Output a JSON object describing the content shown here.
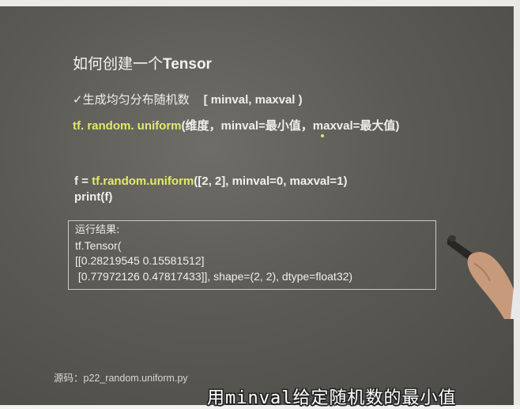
{
  "slide": {
    "title_cn": "如何创建一个",
    "title_en": "Tensor",
    "bullet": "✓生成均匀分布随机数",
    "bullet_range": "[ minval, maxval )",
    "api_prefix": "tf. random. uniform",
    "api_args": "(维度，minval=最小值，maxval=最大值)",
    "code_line1_prefix": "f = ",
    "code_line1_func": "tf.random.uniform",
    "code_line1_args": "([2, 2], minval=0, maxval=1)",
    "code_line2": "print(f)",
    "result_label": "运行结果:",
    "result_line1": "tf.Tensor(",
    "result_line2": "[[0.28219545 0.15581512]",
    "result_line3": " [0.77972126 0.47817433]], shape=(2, 2), dtype=float32)",
    "source": "源码：p22_random.uniform.py"
  },
  "subtitle": {
    "part1": "用",
    "part2": "minval",
    "part3": "给定随机数的最小值"
  },
  "colors": {
    "screen": "#5b5a55",
    "highlight": "#e3ea6a",
    "text": "#f0f0ea"
  }
}
